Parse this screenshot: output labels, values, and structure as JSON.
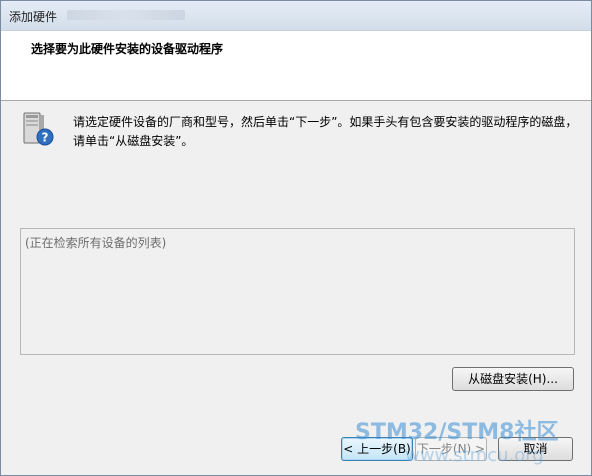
{
  "window": {
    "title": "添加硬件"
  },
  "header": {
    "title": "选择要为此硬件安装的设备驱动程序"
  },
  "content": {
    "icon": "hardware-device-help-icon",
    "description": "请选定硬件设备的厂商和型号，然后单击“下一步”。如果手头有包含要安装的驱动程序的磁盘，请单击“从磁盘安装”。"
  },
  "device_list": {
    "status_text": "(正在检索所有设备的列表)"
  },
  "buttons": {
    "have_disk": "从磁盘安装(H)...",
    "back": "< 上一步(B)",
    "next": "下一步(N) >",
    "cancel": "取消"
  },
  "watermark": {
    "text": "STM32/STM8社区",
    "sub": "www.stmcu.org"
  }
}
